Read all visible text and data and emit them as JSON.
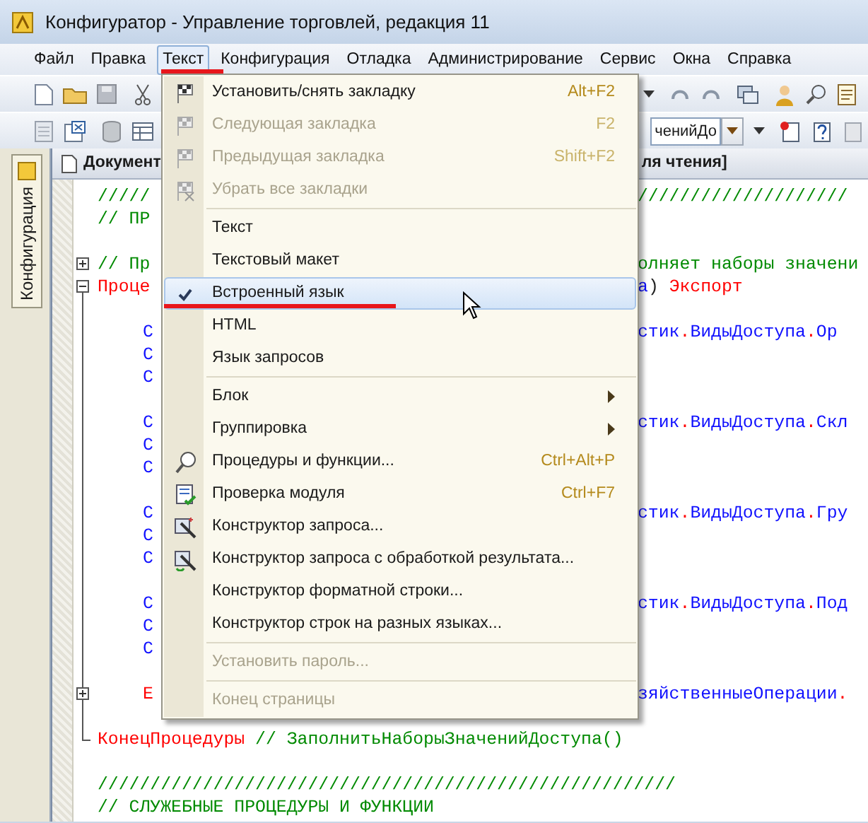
{
  "window": {
    "title": "Конфигуратор - Управление торговлей, редакция 11"
  },
  "menubar": [
    {
      "label": "Файл",
      "selected": false
    },
    {
      "label": "Правка",
      "selected": false
    },
    {
      "label": "Текст",
      "selected": true
    },
    {
      "label": "Конфигурация",
      "selected": false
    },
    {
      "label": "Отладка",
      "selected": false
    },
    {
      "label": "Администрирование",
      "selected": false
    },
    {
      "label": "Сервис",
      "selected": false
    },
    {
      "label": "Окна",
      "selected": false
    },
    {
      "label": "Справка",
      "selected": false
    }
  ],
  "toolbar": {
    "combo_value": "ченийДо"
  },
  "side_panel": {
    "tab_label": "Конфигурация"
  },
  "document": {
    "title": "Документ",
    "title_tail": "ля чтения]",
    "lines": [
      {
        "kind": "split",
        "left": [
          {
            "kind": "comment",
            "text": "/////"
          }
        ],
        "right": [
          {
            "kind": "comment",
            "text": "////////////////////"
          }
        ]
      },
      {
        "kind": "split",
        "left": [
          {
            "kind": "comment",
            "text": "// ПР"
          }
        ]
      },
      {
        "kind": "blank"
      },
      {
        "kind": "split",
        "fold": {
          "expanded": false
        },
        "left": [
          {
            "kind": "comment",
            "text": "// Пр"
          }
        ],
        "right": [
          {
            "kind": "comment",
            "text": "олняет наборы значени"
          }
        ]
      },
      {
        "kind": "split",
        "fold": {
          "expanded": true
        },
        "left": [
          {
            "kind": "keyword",
            "text": "Проце"
          }
        ],
        "right": [
          {
            "kind": "ident",
            "text": "а"
          },
          {
            "kind": "plain",
            "text": ") "
          },
          {
            "kind": "keyword",
            "text": "Экспорт"
          }
        ]
      },
      {
        "kind": "blank"
      },
      {
        "kind": "split",
        "indent": true,
        "left": [
          {
            "kind": "ident",
            "text": "С"
          }
        ],
        "right": [
          {
            "kind": "ident",
            "text": "стик"
          },
          {
            "kind": "punct",
            "text": "."
          },
          {
            "kind": "ident",
            "text": "ВидыДоступа"
          },
          {
            "kind": "punct",
            "text": "."
          },
          {
            "kind": "ident",
            "text": "Ор"
          }
        ]
      },
      {
        "kind": "split",
        "indent": true,
        "left": [
          {
            "kind": "ident",
            "text": "С"
          }
        ]
      },
      {
        "kind": "split",
        "indent": true,
        "left": [
          {
            "kind": "ident",
            "text": "С"
          }
        ]
      },
      {
        "kind": "blank"
      },
      {
        "kind": "split",
        "indent": true,
        "left": [
          {
            "kind": "ident",
            "text": "С"
          }
        ],
        "right": [
          {
            "kind": "ident",
            "text": "стик"
          },
          {
            "kind": "punct",
            "text": "."
          },
          {
            "kind": "ident",
            "text": "ВидыДоступа"
          },
          {
            "kind": "punct",
            "text": "."
          },
          {
            "kind": "ident",
            "text": "Скл"
          }
        ]
      },
      {
        "kind": "split",
        "indent": true,
        "left": [
          {
            "kind": "ident",
            "text": "С"
          }
        ]
      },
      {
        "kind": "split",
        "indent": true,
        "left": [
          {
            "kind": "ident",
            "text": "С"
          }
        ]
      },
      {
        "kind": "blank"
      },
      {
        "kind": "split",
        "indent": true,
        "left": [
          {
            "kind": "ident",
            "text": "С"
          }
        ],
        "right": [
          {
            "kind": "ident",
            "text": "стик"
          },
          {
            "kind": "punct",
            "text": "."
          },
          {
            "kind": "ident",
            "text": "ВидыДоступа"
          },
          {
            "kind": "punct",
            "text": "."
          },
          {
            "kind": "ident",
            "text": "Гру"
          }
        ]
      },
      {
        "kind": "split",
        "indent": true,
        "left": [
          {
            "kind": "ident",
            "text": "С"
          }
        ]
      },
      {
        "kind": "split",
        "indent": true,
        "left": [
          {
            "kind": "ident",
            "text": "С"
          }
        ]
      },
      {
        "kind": "blank"
      },
      {
        "kind": "split",
        "indent": true,
        "left": [
          {
            "kind": "ident",
            "text": "С"
          }
        ],
        "right": [
          {
            "kind": "ident",
            "text": "стик"
          },
          {
            "kind": "punct",
            "text": "."
          },
          {
            "kind": "ident",
            "text": "ВидыДоступа"
          },
          {
            "kind": "punct",
            "text": "."
          },
          {
            "kind": "ident",
            "text": "Под"
          }
        ]
      },
      {
        "kind": "split",
        "indent": true,
        "left": [
          {
            "kind": "ident",
            "text": "С"
          }
        ]
      },
      {
        "kind": "split",
        "indent": true,
        "left": [
          {
            "kind": "ident",
            "text": "С"
          }
        ]
      },
      {
        "kind": "blank"
      },
      {
        "kind": "split",
        "fold": {
          "expanded": false
        },
        "indent": true,
        "left": [
          {
            "kind": "keyword",
            "text": "Е"
          }
        ],
        "right": [
          {
            "kind": "ident",
            "text": "зяйственныеОперации"
          },
          {
            "kind": "punct",
            "text": "."
          }
        ]
      },
      {
        "kind": "blank"
      },
      {
        "kind": "full",
        "block_end": true,
        "tokens": [
          {
            "kind": "keyword",
            "text": "КонецПроцедуры"
          },
          {
            "kind": "comment",
            "text": " // ЗаполнитьНаборыЗначенийДоступа()"
          }
        ]
      },
      {
        "kind": "blank"
      },
      {
        "kind": "full",
        "tokens": [
          {
            "kind": "comment",
            "text": "///////////////////////////////////////////////////////"
          }
        ]
      },
      {
        "kind": "full",
        "tokens": [
          {
            "kind": "comment",
            "text": "// СЛУЖЕБНЫЕ ПРОЦЕДУРЫ И ФУНКЦИИ"
          }
        ]
      }
    ]
  },
  "text_menu": {
    "items": [
      {
        "kind": "item",
        "label": "Установить/снять закладку",
        "shortcut": "Alt+F2",
        "icon": true,
        "disabled": false,
        "checked": false,
        "highlighted": false
      },
      {
        "kind": "item",
        "label": "Следующая закладка",
        "shortcut": "F2",
        "icon": true,
        "disabled": true,
        "checked": false,
        "highlighted": false
      },
      {
        "kind": "item",
        "label": "Предыдущая закладка",
        "shortcut": "Shift+F2",
        "icon": true,
        "disabled": true,
        "checked": false,
        "highlighted": false
      },
      {
        "kind": "item",
        "label": "Убрать все закладки",
        "icon": true,
        "disabled": true,
        "checked": false,
        "highlighted": false
      },
      {
        "kind": "separator"
      },
      {
        "kind": "item",
        "label": "Текст",
        "disabled": false,
        "checked": false,
        "highlighted": false
      },
      {
        "kind": "item",
        "label": "Текстовый макет",
        "disabled": false,
        "checked": false,
        "highlighted": false
      },
      {
        "kind": "item",
        "label": "Встроенный язык",
        "disabled": false,
        "checked": true,
        "highlighted": true
      },
      {
        "kind": "item",
        "label": "HTML",
        "disabled": false,
        "checked": false,
        "highlighted": false
      },
      {
        "kind": "item",
        "label": "Язык запросов",
        "disabled": false,
        "checked": false,
        "highlighted": false
      },
      {
        "kind": "separator"
      },
      {
        "kind": "item",
        "label": "Блок",
        "submenu": true,
        "disabled": false,
        "checked": false,
        "highlighted": false
      },
      {
        "kind": "item",
        "label": "Группировка",
        "submenu": true,
        "disabled": false,
        "checked": false,
        "highlighted": false
      },
      {
        "kind": "item",
        "label": "Процедуры и функции...",
        "shortcut": "Ctrl+Alt+P",
        "icon": true,
        "disabled": false,
        "checked": false,
        "highlighted": false
      },
      {
        "kind": "item",
        "label": "Проверка модуля",
        "shortcut": "Ctrl+F7",
        "icon": true,
        "disabled": false,
        "checked": false,
        "highlighted": false
      },
      {
        "kind": "item",
        "label": "Конструктор запроса...",
        "icon": true,
        "disabled": false,
        "checked": false,
        "highlighted": false
      },
      {
        "kind": "item",
        "label": "Конструктор запроса с обработкой результата...",
        "icon": true,
        "disabled": false,
        "checked": false,
        "highlighted": false
      },
      {
        "kind": "item",
        "label": "Конструктор форматной строки...",
        "disabled": false,
        "checked": false,
        "highlighted": false
      },
      {
        "kind": "item",
        "label": "Конструктор строк на разных языках...",
        "disabled": false,
        "checked": false,
        "highlighted": false
      },
      {
        "kind": "separator"
      },
      {
        "kind": "item",
        "label": "Установить пароль...",
        "disabled": true,
        "checked": false,
        "highlighted": false
      },
      {
        "kind": "separator"
      },
      {
        "kind": "item",
        "label": "Конец страницы",
        "disabled": true,
        "checked": false,
        "highlighted": false
      }
    ]
  }
}
